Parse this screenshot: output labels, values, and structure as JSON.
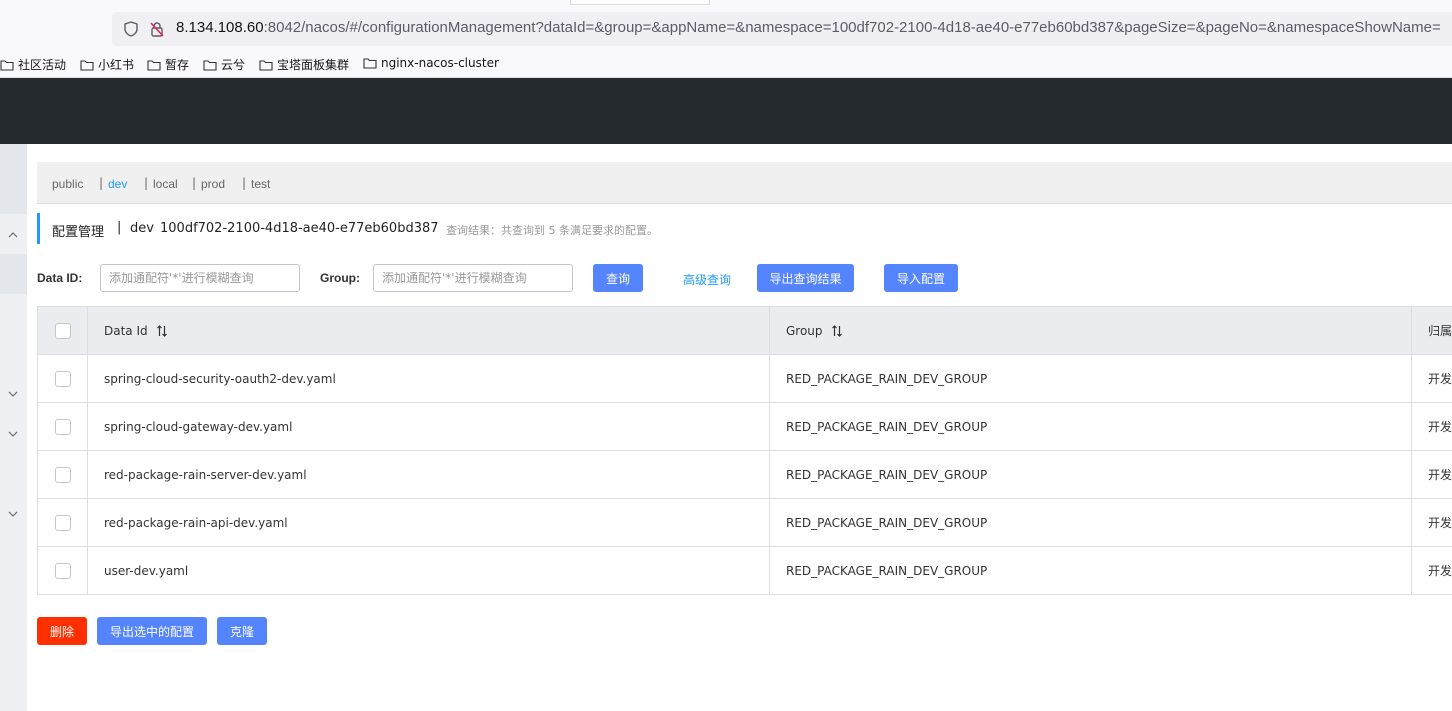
{
  "browser": {
    "url_host": "8.134.108.60",
    "url_rest": ":8042/nacos/#/configurationManagement?dataId=&group=&appName=&namespace=100df702-2100-4d18-ae40-e77eb60bd387&pageSize=&pageNo=&namespaceShowName=",
    "bookmarks": [
      "社区活动",
      "小红书",
      "暂存",
      "云兮",
      "宝塔面板集群",
      "nginx-nacos-cluster"
    ]
  },
  "namespaces": [
    {
      "label": "public",
      "active": false
    },
    {
      "label": "dev",
      "active": true
    },
    {
      "label": "local",
      "active": false
    },
    {
      "label": "prod",
      "active": false
    },
    {
      "label": "test",
      "active": false
    }
  ],
  "title": {
    "main": "配置管理",
    "separator": "|",
    "namespace_name": "dev",
    "namespace_id": "100df702-2100-4d18-ae40-e77eb60bd387",
    "result_text": "查询结果：共查询到 5 条满足要求的配置。"
  },
  "search": {
    "dataid_label": "Data ID:",
    "dataid_placeholder": "添加通配符'*'进行模糊查询",
    "group_label": "Group:",
    "group_placeholder": "添加通配符'*'进行模糊查询",
    "query_button": "查询",
    "advanced_link": "高级查询",
    "export_result_button": "导出查询结果",
    "import_button": "导入配置"
  },
  "table": {
    "headers": {
      "data_id": "Data Id",
      "group": "Group",
      "app": "归属"
    },
    "rows": [
      {
        "data_id": "spring-cloud-security-oauth2-dev.yaml",
        "group": "RED_PACKAGE_RAIN_DEV_GROUP",
        "app": "开发"
      },
      {
        "data_id": "spring-cloud-gateway-dev.yaml",
        "group": "RED_PACKAGE_RAIN_DEV_GROUP",
        "app": "开发"
      },
      {
        "data_id": "red-package-rain-server-dev.yaml",
        "group": "RED_PACKAGE_RAIN_DEV_GROUP",
        "app": "开发"
      },
      {
        "data_id": "red-package-rain-api-dev.yaml",
        "group": "RED_PACKAGE_RAIN_DEV_GROUP",
        "app": "开发"
      },
      {
        "data_id": "user-dev.yaml",
        "group": "RED_PACKAGE_RAIN_DEV_GROUP",
        "app": "开发"
      }
    ]
  },
  "footer": {
    "delete_button": "删除",
    "export_selected_button": "导出选中的配置",
    "clone_button": "克隆"
  },
  "colors": {
    "primary": "#5584ff",
    "danger": "#ff3000",
    "link": "#209bfa",
    "header_bg": "#252a2f"
  }
}
